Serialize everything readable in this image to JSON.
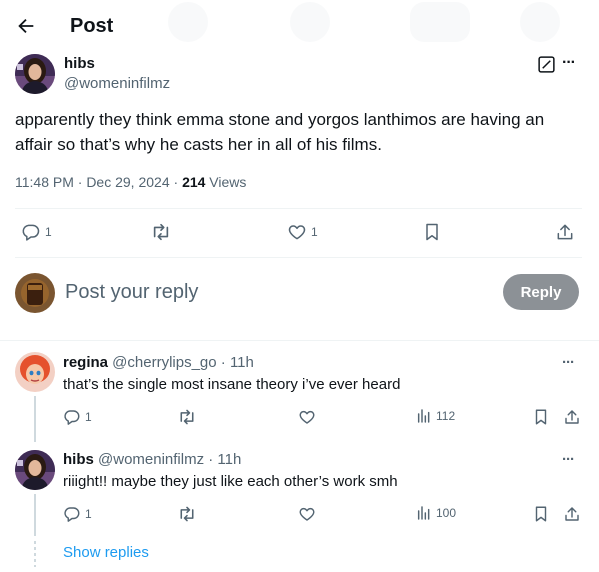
{
  "header": {
    "title": "Post"
  },
  "post": {
    "author_name": "hibs",
    "author_handle": "@womeninfilmz",
    "text": "apparently they think emma stone and yorgos lanthimos are having an affair so that’s why he casts her in all of his films.",
    "time": "11:48 PM · Dec 29, 2024 · ",
    "views_count": "214",
    "views_label": " Views",
    "reply_count": "1",
    "like_count": "1",
    "more_label": "···"
  },
  "composer": {
    "placeholder": "Post your reply",
    "button_label": "Reply"
  },
  "replies": [
    {
      "name": "regina",
      "meta": " @cherrylips_go · 11h",
      "text": "that’s the single most insane theory i’ve ever heard",
      "reply_count": "1",
      "views": "112",
      "more_label": "···"
    },
    {
      "name": "hibs",
      "meta": " @womeninfilmz · 11h",
      "text": "riiight!! maybe they just like each other’s work smh",
      "reply_count": "1",
      "views": "100",
      "more_label": "···"
    }
  ],
  "show_replies_label": "Show replies",
  "icons": {
    "back": "arrow-left-icon",
    "grok": "grok-icon",
    "reply": "reply-icon",
    "repost": "repost-icon",
    "like": "heart-icon",
    "bookmark": "bookmark-icon",
    "share": "share-icon",
    "views": "analytics-icon"
  },
  "colors": {
    "accent": "#1d9bf0",
    "reply_button": "#8c9196",
    "muted_text": "#536471"
  }
}
